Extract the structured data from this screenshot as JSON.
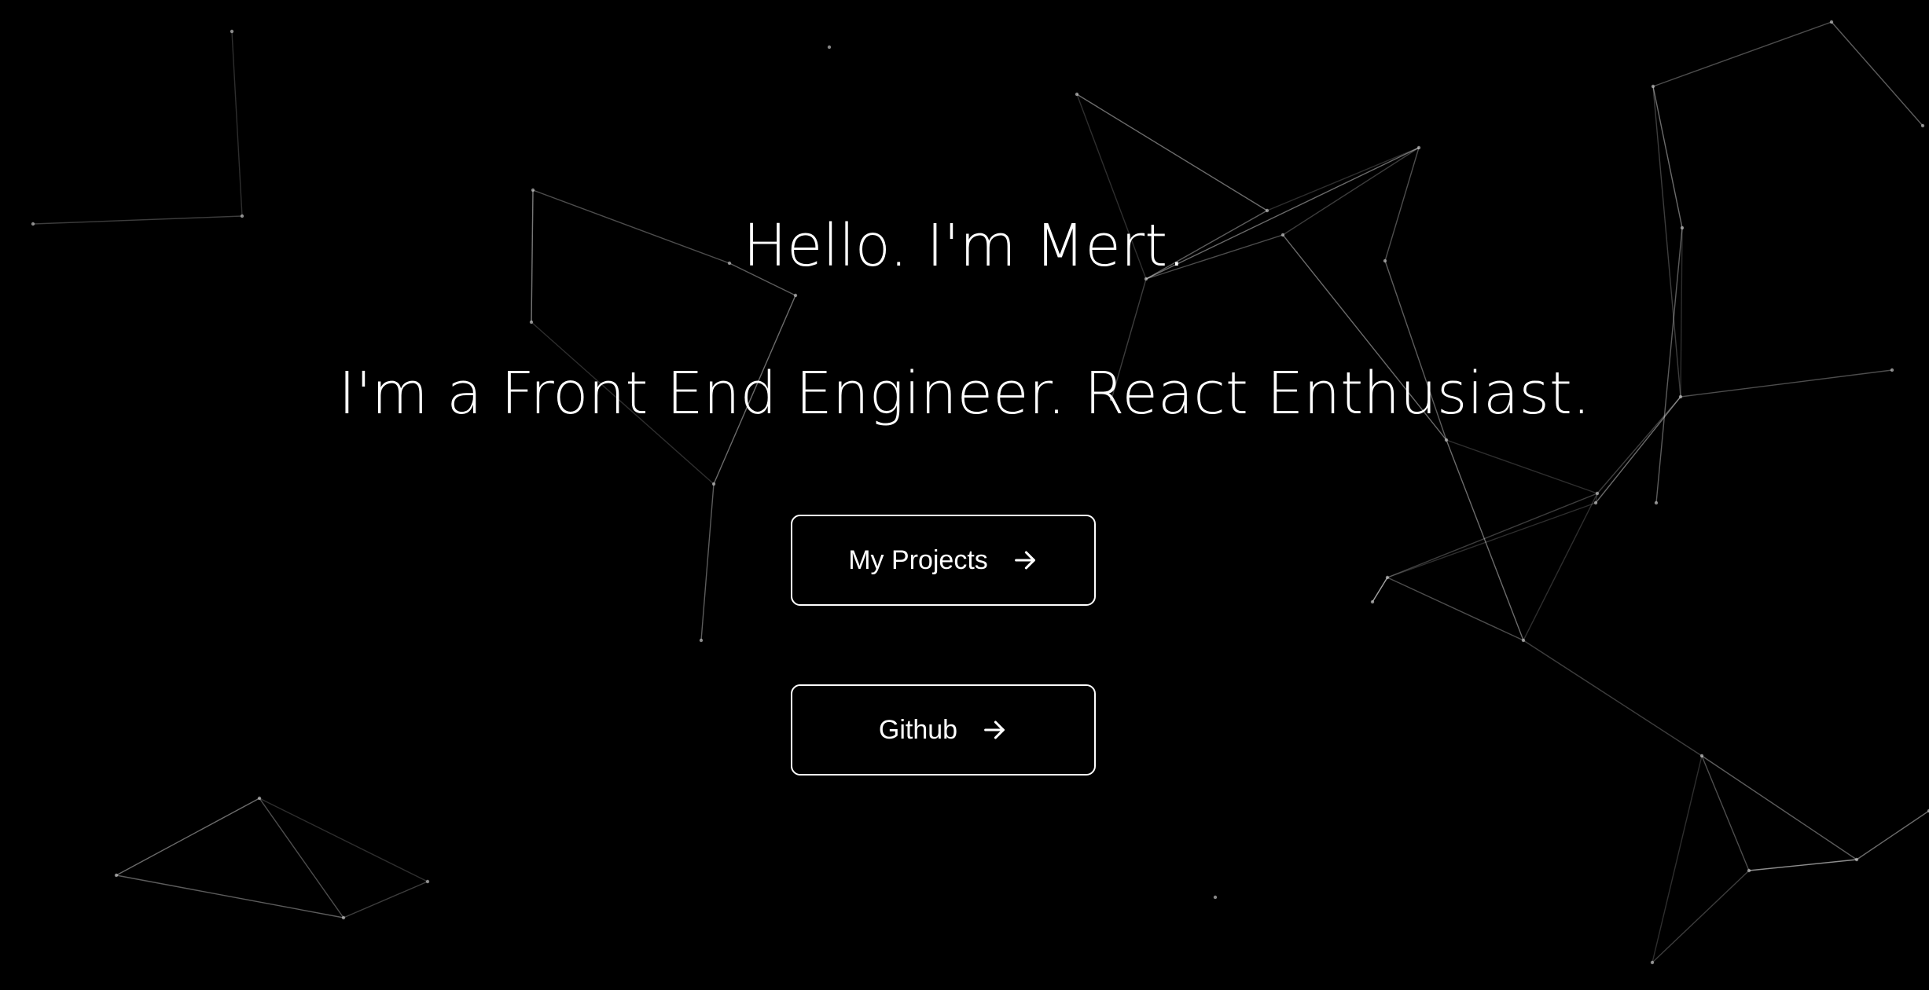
{
  "hero": {
    "greeting": "Hello. I'm Mert.",
    "tagline": "I'm a Front End Engineer. React Enthusiast."
  },
  "actions": {
    "projects_label": "My Projects",
    "github_label": "Github",
    "arrow_icon": "arrow-right-icon"
  },
  "colors": {
    "background": "#000000",
    "foreground": "#ffffff",
    "network_line": "#ffffff"
  },
  "background_effect": "particle-network"
}
